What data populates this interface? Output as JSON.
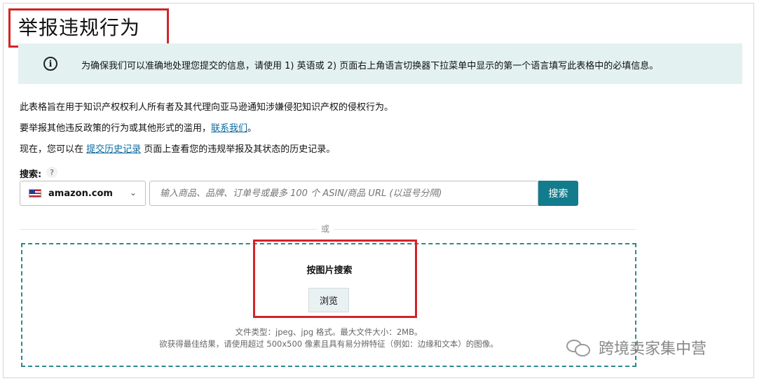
{
  "page": {
    "title": "举报违规行为"
  },
  "info_banner": {
    "icon": "info-icon",
    "icon_glyph": "i",
    "text": "为确保我们可以准确地处理您提交的信息，请使用 1) 英语或 2) 页面右上角语言切换器下拉菜单中显示的第一个语言填写此表格中的必填信息。"
  },
  "intro": {
    "line1": "此表格旨在用于知识产权权利人所有者及其代理向亚马逊通知涉嫌侵犯知识产权的侵权行为。",
    "line2_before": "要举报其他违反政策的行为或其他形式的滥用，",
    "line2_link": "联系我们",
    "line2_after": "。",
    "line3_before": "现在，您可以在 ",
    "line3_link": "提交历史记录",
    "line3_after": " 页面上查看您的违规举报及其状态的历史记录。"
  },
  "search": {
    "label": "搜索:",
    "help_glyph": "?",
    "marketplace": "amazon.com",
    "marketplace_chevron": "⌄",
    "placeholder": "输入商品、品牌、订单号或最多 100 个 ASIN/商品 URL (以逗号分隔)",
    "button_label": "搜索"
  },
  "divider": {
    "or_label": "或"
  },
  "image_search": {
    "title": "按图片搜索",
    "browse_label": "浏览",
    "note1": "文件类型：jpeg、jpg 格式。最大文件大小：2MB。",
    "note2": "欲获得最佳结果，请使用超过 500x500 像素且具有易分辨特征（例如：边缘和文本）的图像。"
  },
  "watermark": {
    "text": "跨境卖家集中营"
  },
  "colors": {
    "accent": "#127c8d",
    "highlight_red": "#d3232a",
    "banner_bg": "#e3f1f1",
    "link": "#0a6a9e",
    "dash_border": "#2c8a8a"
  }
}
